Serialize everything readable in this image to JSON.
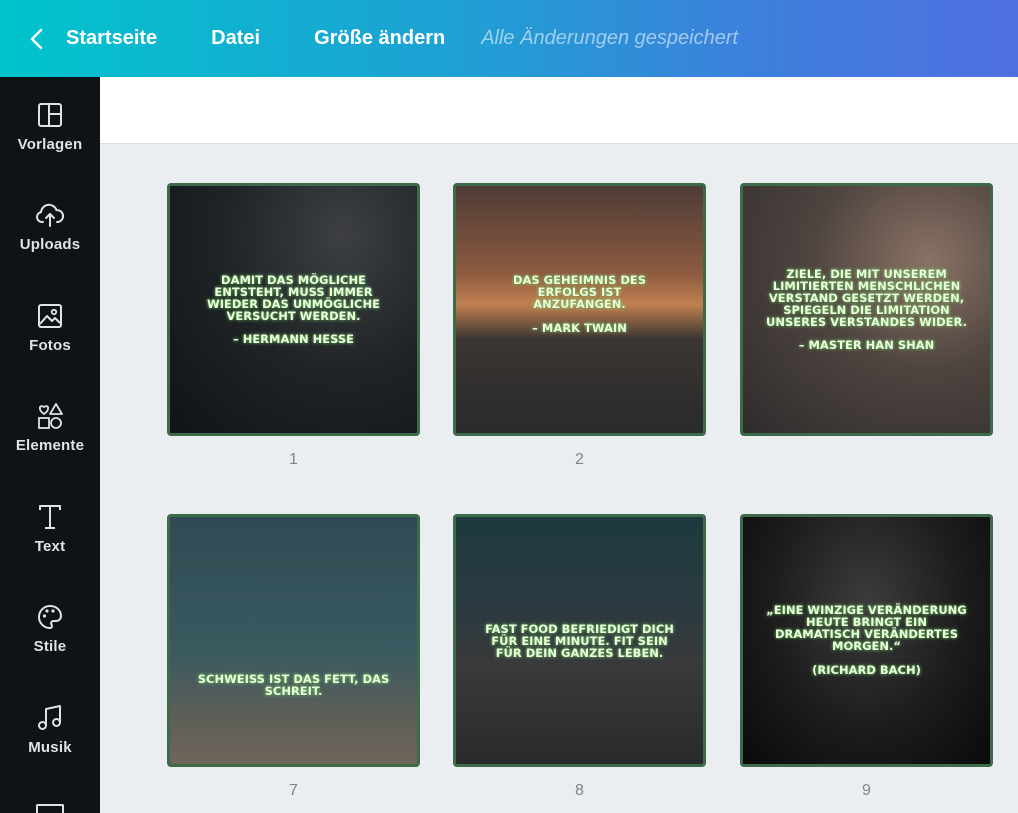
{
  "topbar": {
    "home_label": "Startseite",
    "file_label": "Datei",
    "resize_label": "Größe ändern",
    "status_text": "Alle Änderungen gespeichert",
    "gradient_start": "#00c4cc",
    "gradient_end": "#4f6fe0"
  },
  "sidebar": {
    "items": [
      {
        "label": "Vorlagen",
        "icon": "layout-icon"
      },
      {
        "label": "Uploads",
        "icon": "cloud-upload-icon"
      },
      {
        "label": "Fotos",
        "icon": "image-icon"
      },
      {
        "label": "Elemente",
        "icon": "shapes-icon"
      },
      {
        "label": "Text",
        "icon": "text-icon"
      },
      {
        "label": "Stile",
        "icon": "palette-icon"
      },
      {
        "label": "Musik",
        "icon": "music-icon"
      }
    ]
  },
  "pages": [
    {
      "number": "1",
      "quote": "Damit das Mögliche entsteht, muss immer wieder das Unmögliche versucht werden.",
      "author": "– Hermann Hesse"
    },
    {
      "number": "2",
      "quote": "Das Geheimnis des Erfolgs ist anzufangen.",
      "author": "– Mark Twain"
    },
    {
      "number": "",
      "quote": "Ziele, die mit unserem limitierten menschlichen Verstand gesetzt werden, spiegeln die Limitation unseres Verstandes wider.",
      "author": "– Master Han Shan"
    },
    {
      "number": "7",
      "quote": "Schweiß ist das Fett, das schreit.",
      "author": ""
    },
    {
      "number": "8",
      "quote": "Fast Food befriedigt dich für eine Minute. Fit sein für dein ganzes Leben.",
      "author": ""
    },
    {
      "number": "9",
      "quote": "„Eine winzige Veränderung heute bringt ein dramatisch verändertes Morgen.“",
      "author": "(Richard Bach)"
    }
  ]
}
